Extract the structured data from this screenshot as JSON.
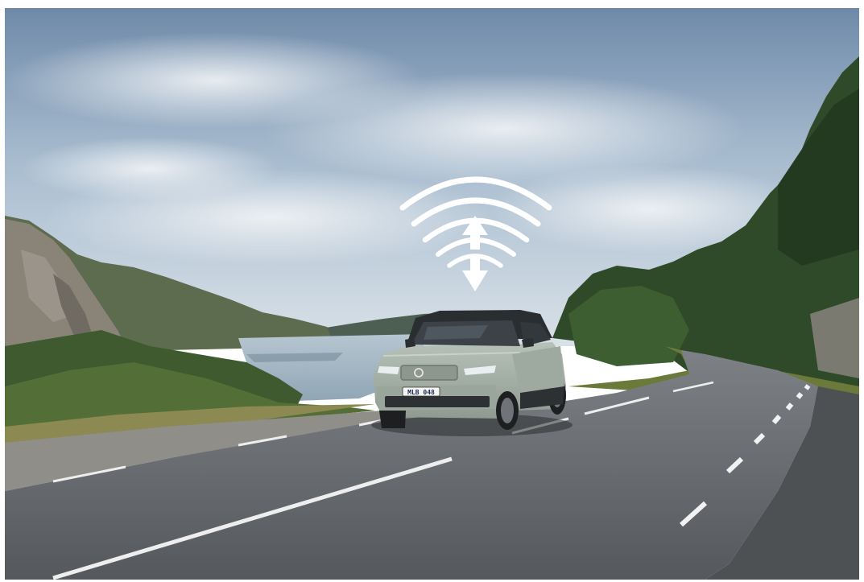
{
  "photo": {
    "scene": "road-by-lake",
    "vehicle": {
      "plate_text": "MLB 048",
      "body_color": "#a9b5aa",
      "roof_color": "#2b2e31"
    },
    "overlay": {
      "icon": "wifi-signal-upload-download-icon",
      "color": "#ffffff"
    },
    "colors": {
      "sky_top": "#7b95b3",
      "sky_bottom": "#d4dde6",
      "water": "#9eb5c4",
      "road": "#606468",
      "forest": "#2f4a28",
      "rock": "#8a8478"
    }
  }
}
